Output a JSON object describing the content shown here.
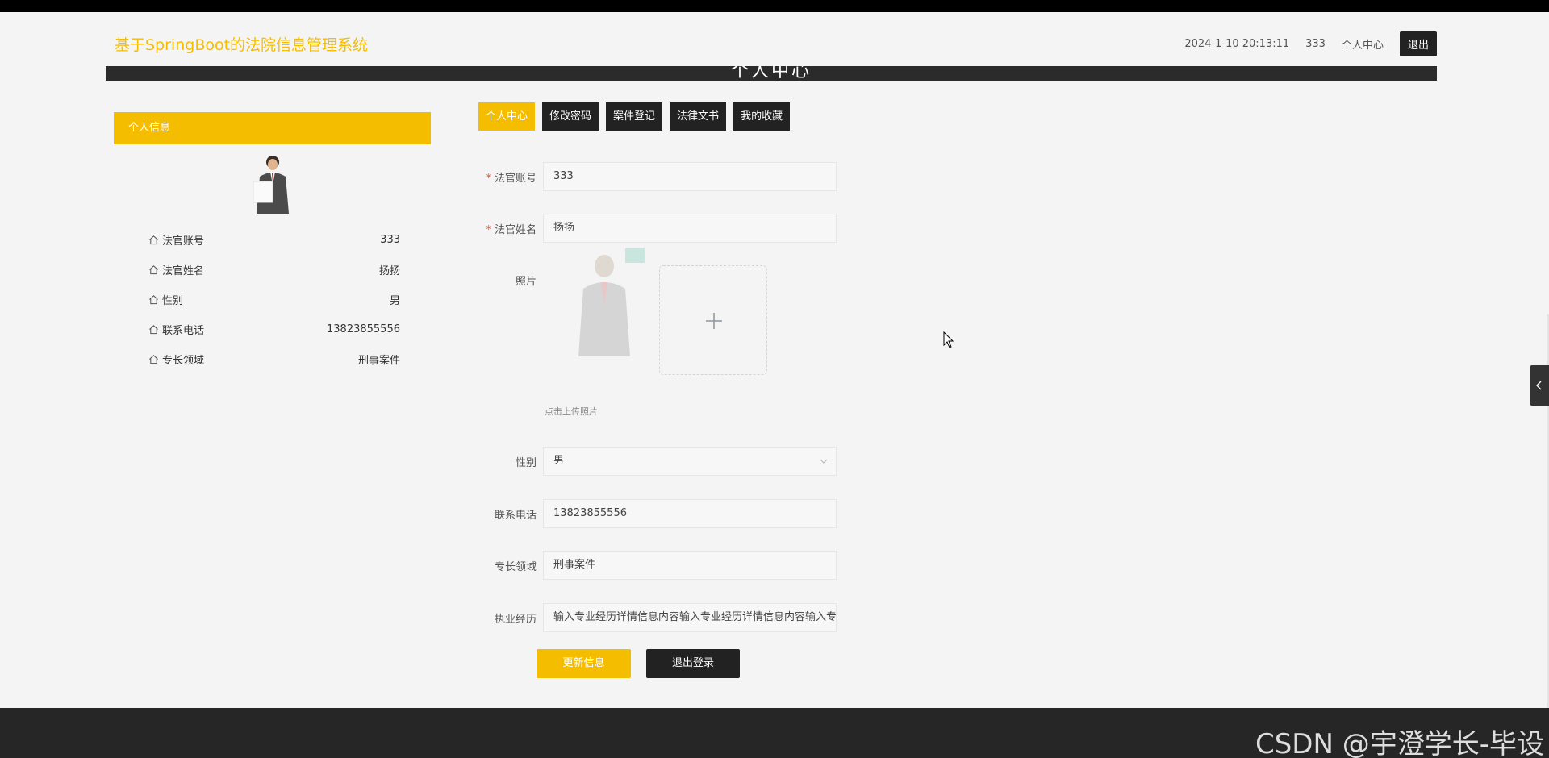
{
  "header": {
    "site_title": "基于SpringBoot的法院信息管理系统",
    "datetime": "2024-1-10 20:13:11",
    "username": "333",
    "profile_link": "个人中心",
    "logout_label": "退出"
  },
  "banner": {
    "title": "个人中心"
  },
  "left_panel": {
    "heading": "个人信息",
    "rows": [
      {
        "label": "法官账号",
        "value": "333"
      },
      {
        "label": "法官姓名",
        "value": "扬扬"
      },
      {
        "label": "性别",
        "value": "男"
      },
      {
        "label": "联系电话",
        "value": "13823855556"
      },
      {
        "label": "专长领域",
        "value": "刑事案件"
      }
    ]
  },
  "tabs": [
    {
      "label": "个人中心",
      "active": true
    },
    {
      "label": "修改密码",
      "active": false
    },
    {
      "label": "案件登记",
      "active": false
    },
    {
      "label": "法律文书",
      "active": false
    },
    {
      "label": "我的收藏",
      "active": false
    }
  ],
  "form": {
    "account": {
      "label": "法官账号",
      "value": "333"
    },
    "name": {
      "label": "法官姓名",
      "value": "扬扬"
    },
    "photo": {
      "label": "照片",
      "tip": "点击上传照片"
    },
    "gender": {
      "label": "性别",
      "value": "男"
    },
    "phone": {
      "label": "联系电话",
      "value": "13823855556"
    },
    "specialty": {
      "label": "专长领域",
      "value": "刑事案件"
    },
    "experience": {
      "label": "执业经历",
      "value": "输入专业经历详情信息内容输入专业经历详情信息内容输入专业经历详情信息内容"
    }
  },
  "buttons": {
    "update": "更新信息",
    "logout": "退出登录"
  },
  "watermark": "CSDN @宇澄学长-毕设",
  "colors": {
    "accent": "#f5bd00",
    "dark": "#222222",
    "footer": "#262626"
  }
}
